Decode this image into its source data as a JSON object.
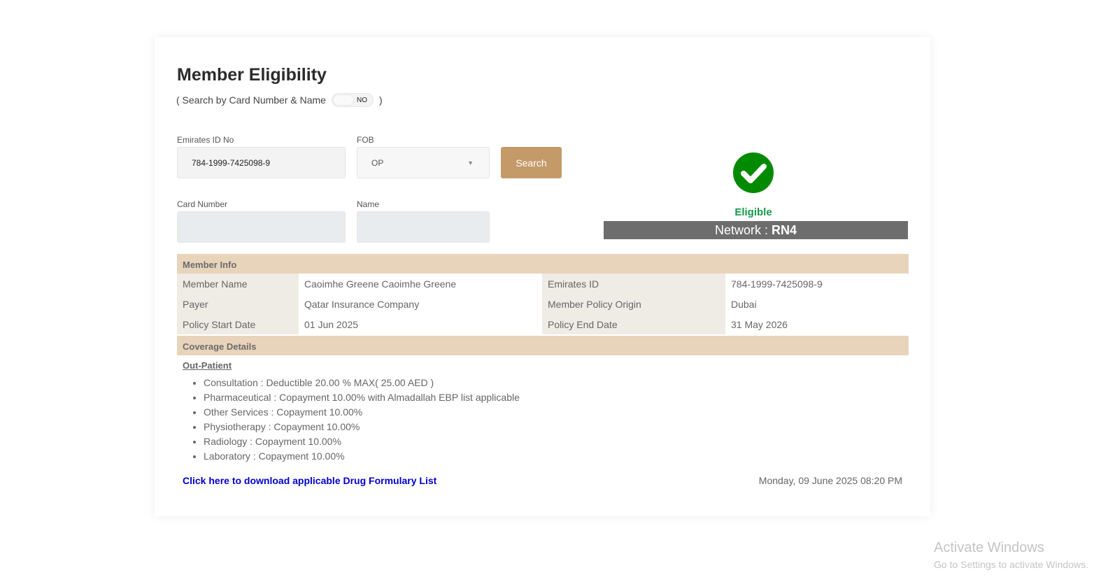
{
  "title": "Member Eligibility",
  "search_toggle": {
    "prefix": "( Search by Card Number & Name",
    "state": "NO",
    "suffix": ")"
  },
  "form": {
    "emirates_label": "Emirates ID No",
    "emirates_value": "784-1999-7425098-9",
    "fob_label": "FOB",
    "fob_value": "OP",
    "search_label": "Search",
    "card_label": "Card Number",
    "card_value": "",
    "name_label": "Name",
    "name_value": ""
  },
  "status": {
    "label": "Eligible",
    "network_prefix": "Network : ",
    "network": "RN4",
    "color": "#038a03"
  },
  "member_info": {
    "header": "Member Info",
    "rows": [
      {
        "k1": "Member Name",
        "v1": "Caoimhe Greene Caoimhe Greene",
        "k2": "Emirates ID",
        "v2": "784-1999-7425098-9"
      },
      {
        "k1": "Payer",
        "v1": "Qatar Insurance Company",
        "k2": "Member Policy Origin",
        "v2": "Dubai"
      },
      {
        "k1": "Policy Start Date",
        "v1": "01 Jun 2025",
        "k2": "Policy End Date",
        "v2": "31 May 2026"
      }
    ]
  },
  "coverage": {
    "header": "Coverage Details",
    "section": "Out-Patient",
    "items": [
      "Consultation : Deductible 20.00 % MAX( 25.00 AED )",
      "Pharmaceutical : Copayment 10.00% with Almadallah EBP list applicable",
      "Other Services : Copayment 10.00%",
      "Physiotherapy : Copayment 10.00%",
      "Radiology : Copayment 10.00%",
      "Laboratory : Copayment 10.00%"
    ]
  },
  "download_link": "Click here to download applicable Drug Formulary List",
  "timestamp": "Monday, 09 June 2025 08:20 PM",
  "watermark": {
    "line1": "Activate Windows",
    "line2": "Go to Settings to activate Windows."
  }
}
